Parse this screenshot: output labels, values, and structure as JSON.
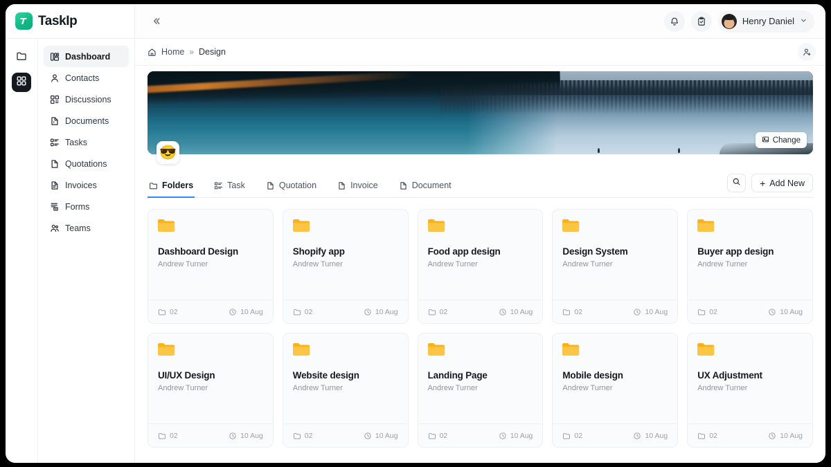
{
  "app": {
    "brand_name": "TaskIp",
    "logo_icon": "taskip-logo-icon",
    "collapse_icon": "chevrons-left-icon"
  },
  "topbar": {
    "notifications_icon": "bell-icon",
    "tasks_icon": "clipboard-check-icon",
    "user": {
      "name": "Henry Daniel",
      "avatar_icon": "user-avatar",
      "chevron_icon": "chevron-down-icon"
    }
  },
  "rail": {
    "items": [
      {
        "icon": "folder-icon",
        "active": false
      },
      {
        "icon": "grid-apps-icon",
        "active": true
      }
    ]
  },
  "sidebar": {
    "items": [
      {
        "label": "Dashboard",
        "icon": "dashboard-icon",
        "active": true
      },
      {
        "label": "Contacts",
        "icon": "contacts-icon",
        "active": false
      },
      {
        "label": "Discussions",
        "icon": "discussions-icon",
        "active": false
      },
      {
        "label": "Documents",
        "icon": "documents-icon",
        "active": false
      },
      {
        "label": "Tasks",
        "icon": "tasks-icon",
        "active": false
      },
      {
        "label": "Quotations",
        "icon": "quotations-icon",
        "active": false
      },
      {
        "label": "Invoices",
        "icon": "invoices-icon",
        "active": false
      },
      {
        "label": "Forms",
        "icon": "forms-icon",
        "active": false
      },
      {
        "label": "Teams",
        "icon": "teams-icon",
        "active": false
      }
    ]
  },
  "breadcrumb": {
    "home_icon": "home-icon",
    "home": "Home",
    "separator": "»",
    "current": "Design",
    "action_icon": "add-member-icon"
  },
  "banner": {
    "change_label": "Change",
    "change_icon": "image-icon",
    "emoji": "😎"
  },
  "tabs": {
    "items": [
      {
        "label": "Folders",
        "icon": "folder-icon",
        "active": true
      },
      {
        "label": "Task",
        "icon": "tasks-icon",
        "active": false
      },
      {
        "label": "Quotation",
        "icon": "document-icon",
        "active": false
      },
      {
        "label": "Invoice",
        "icon": "document-icon",
        "active": false
      },
      {
        "label": "Document",
        "icon": "document-icon",
        "active": false
      }
    ],
    "search_icon": "search-icon",
    "add_new_label": "Add New",
    "add_new_plus": "+",
    "active_underline_color": "#3b82f6"
  },
  "folders": [
    {
      "title": "Dashboard Design",
      "owner": "Andrew Turner",
      "count": "02",
      "date": "10 Aug"
    },
    {
      "title": "Shopify app",
      "owner": "Andrew Turner",
      "count": "02",
      "date": "10 Aug"
    },
    {
      "title": "Food app design",
      "owner": "Andrew Turner",
      "count": "02",
      "date": "10 Aug"
    },
    {
      "title": "Design System",
      "owner": "Andrew Turner",
      "count": "02",
      "date": "10 Aug"
    },
    {
      "title": "Buyer app design",
      "owner": "Andrew Turner",
      "count": "02",
      "date": "10 Aug"
    },
    {
      "title": "UI/UX Design",
      "owner": "Andrew Turner",
      "count": "02",
      "date": "10 Aug"
    },
    {
      "title": "Website design",
      "owner": "Andrew Turner",
      "count": "02",
      "date": "10 Aug"
    },
    {
      "title": "Landing Page",
      "owner": "Andrew Turner",
      "count": "02",
      "date": "10 Aug"
    },
    {
      "title": "Mobile design",
      "owner": "Andrew Turner",
      "count": "02",
      "date": "10 Aug"
    },
    {
      "title": "UX Adjustment",
      "owner": "Andrew Turner",
      "count": "02",
      "date": "10 Aug"
    }
  ],
  "colors": {
    "brand_green": "#12b886",
    "folder_orange": "#fcb116",
    "accent_blue": "#3b82f6",
    "card_bg": "#fafbfc",
    "text_dark": "#14181f"
  }
}
